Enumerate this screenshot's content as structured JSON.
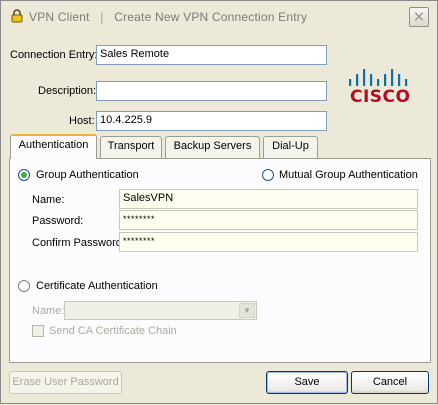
{
  "window": {
    "title_app": "VPN Client",
    "title_separator": "|",
    "title_action": "Create New VPN Connection Entry",
    "close_symbol": "✕"
  },
  "form": {
    "connection_entry": {
      "label": "Connection Entry:",
      "value": "Sales Remote"
    },
    "description": {
      "label": "Description:",
      "value": ""
    },
    "host": {
      "label": "Host:",
      "value": "10.4.225.9"
    }
  },
  "brand": {
    "logo_text": "CISCO",
    "logo_color": "#b40b1f"
  },
  "tabs": [
    {
      "label": "Authentication",
      "active": true
    },
    {
      "label": "Transport",
      "active": false
    },
    {
      "label": "Backup Servers",
      "active": false
    },
    {
      "label": "Dial-Up",
      "active": false
    }
  ],
  "authentication": {
    "group_auth": {
      "label": "Group Authentication",
      "selected": true
    },
    "mutual_group_auth": {
      "label": "Mutual Group Authentication",
      "selected": false
    },
    "name": {
      "label": "Name:",
      "value": "SalesVPN"
    },
    "password": {
      "label": "Password:",
      "value": "********"
    },
    "confirm_password": {
      "label": "Confirm Password:",
      "value": "********"
    },
    "certificate_auth": {
      "label": "Certificate Authentication",
      "selected": false
    },
    "cert_name": {
      "label": "Name:",
      "value": ""
    },
    "send_ca_chain": {
      "label": "Send CA Certificate Chain",
      "checked": false
    }
  },
  "buttons": {
    "erase_password": "Erase User Password",
    "save": "Save",
    "cancel": "Cancel"
  }
}
